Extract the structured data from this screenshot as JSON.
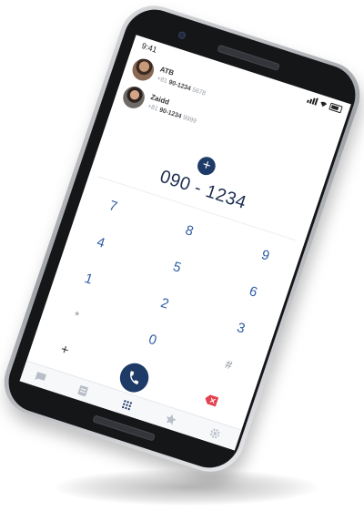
{
  "status_bar": {
    "time": "9:41"
  },
  "recents": [
    {
      "name": "ATB",
      "number_prefix": "+81",
      "number_main": "90-1234",
      "number_suffix": "5678"
    },
    {
      "name": "Zaidd",
      "number_prefix": "+81",
      "number_main": "90-1234",
      "number_suffix": "9999"
    }
  ],
  "dialer": {
    "entered_number": "090 - 1234",
    "keys": [
      {
        "label": "7"
      },
      {
        "label": "8"
      },
      {
        "label": "9"
      },
      {
        "label": "4"
      },
      {
        "label": "5"
      },
      {
        "label": "6"
      },
      {
        "label": "1"
      },
      {
        "label": "2"
      },
      {
        "label": "3"
      },
      {
        "label": "*"
      },
      {
        "label": "0"
      },
      {
        "label": "#"
      },
      {
        "label": "+"
      }
    ]
  },
  "icons": {
    "add": "plus-icon",
    "call": "phone-icon",
    "tabs": [
      "chat-icon",
      "contacts-icon",
      "keypad-icon",
      "star-icon",
      "gear-icon"
    ],
    "delete": "backspace-icon"
  },
  "colors": {
    "accent": "#1e3a66",
    "key_digit": "#2f5ea8",
    "delete": "#e0424f",
    "tab_inactive": "#b8bec8",
    "tab_active": "#1e3a66"
  }
}
